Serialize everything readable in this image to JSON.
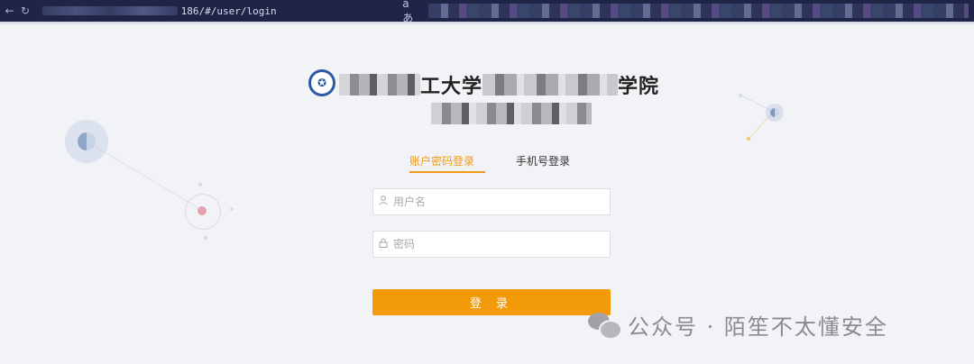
{
  "browser": {
    "url_visible": "186/#/user/login",
    "reader_label": "aあ"
  },
  "header": {
    "title_part1": "工大学",
    "title_part2": "学院"
  },
  "tabs": [
    {
      "label": "账户密码登录",
      "active": true
    },
    {
      "label": "手机号登录",
      "active": false
    }
  ],
  "form": {
    "username_placeholder": "用户名",
    "password_placeholder": "密码",
    "submit_label": "登 录"
  },
  "watermark": {
    "text": "公众号 · 陌笙不太懂安全"
  },
  "colors": {
    "accent": "#f39a09",
    "browser_bar": "#1f2547",
    "background": "#f2f3f7"
  },
  "icons": {
    "back": "arrow-left-icon",
    "reload": "reload-icon",
    "user": "user-icon",
    "lock": "lock-icon",
    "logo": "school-logo",
    "watermark": "wechat-icon"
  }
}
